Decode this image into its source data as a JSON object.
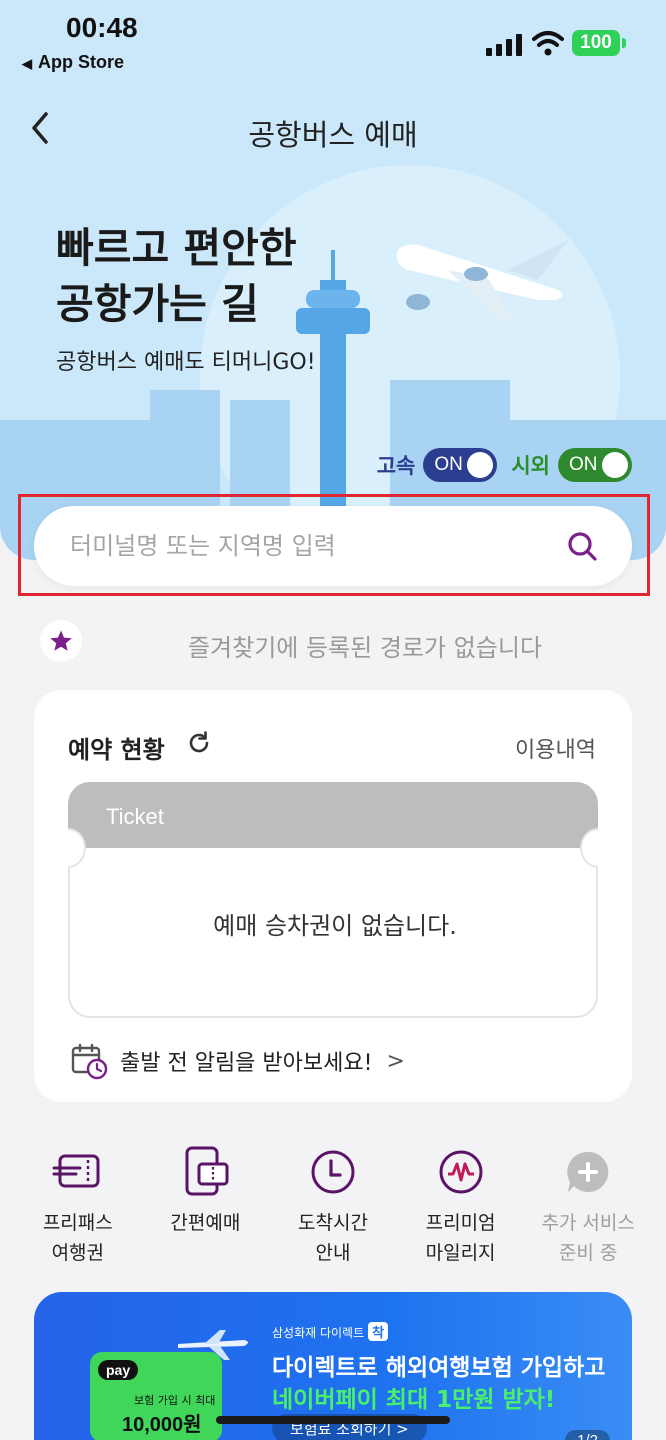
{
  "status_bar": {
    "time": "00:48",
    "back_app": "App Store",
    "battery": "100"
  },
  "nav": {
    "title": "공항버스 예매"
  },
  "hero": {
    "title_line1": "빠르고 편안한",
    "title_line2": "공항가는 길",
    "subtitle": "공항버스 예매도 티머니GO!"
  },
  "toggles": [
    {
      "label": "고속",
      "state": "ON",
      "color": "#2c3e8f"
    },
    {
      "label": "시외",
      "state": "ON",
      "color": "#2f8a2f"
    }
  ],
  "search": {
    "placeholder": "터미널명 또는 지역명 입력",
    "value": ""
  },
  "favorites": {
    "empty_text": "즐겨찾기에 등록된 경로가 없습니다"
  },
  "reservation": {
    "title": "예약 현황",
    "history_link": "이용내역",
    "ticket_label": "Ticket",
    "empty_text": "예매 승차권이 없습니다.",
    "alarm_text": "출발 전 알림을 받아보세요!",
    "alarm_chevron": ">"
  },
  "services": [
    {
      "line1": "프리패스",
      "line2": "여행권",
      "icon": "ticket-icon"
    },
    {
      "line1": "간편예매",
      "line2": "",
      "icon": "phone-ticket-icon"
    },
    {
      "line1": "도착시간",
      "line2": "안내",
      "icon": "clock-icon"
    },
    {
      "line1": "프리미엄",
      "line2": "마일리지",
      "icon": "mileage-icon"
    },
    {
      "line1": "추가 서비스",
      "line2": "준비 중",
      "icon": "plus-chat-icon"
    }
  ],
  "banner": {
    "brand": "삼성화재 다이렉트",
    "brand_badge": "착",
    "npay_badge": "pay",
    "npay_note": "보험 가입 시 최대",
    "npay_amount": "10,000원",
    "line1": "다이렉트로 해외여행보험 가입하고",
    "line2": "네이버페이 최대 1만원 받자!",
    "button": "보험료 조회하기 >",
    "page": "1/2"
  },
  "colors": {
    "accent_purple": "#7b1f8a",
    "hero_bg": "#cbe8fb",
    "highlight": "#e0262e"
  }
}
